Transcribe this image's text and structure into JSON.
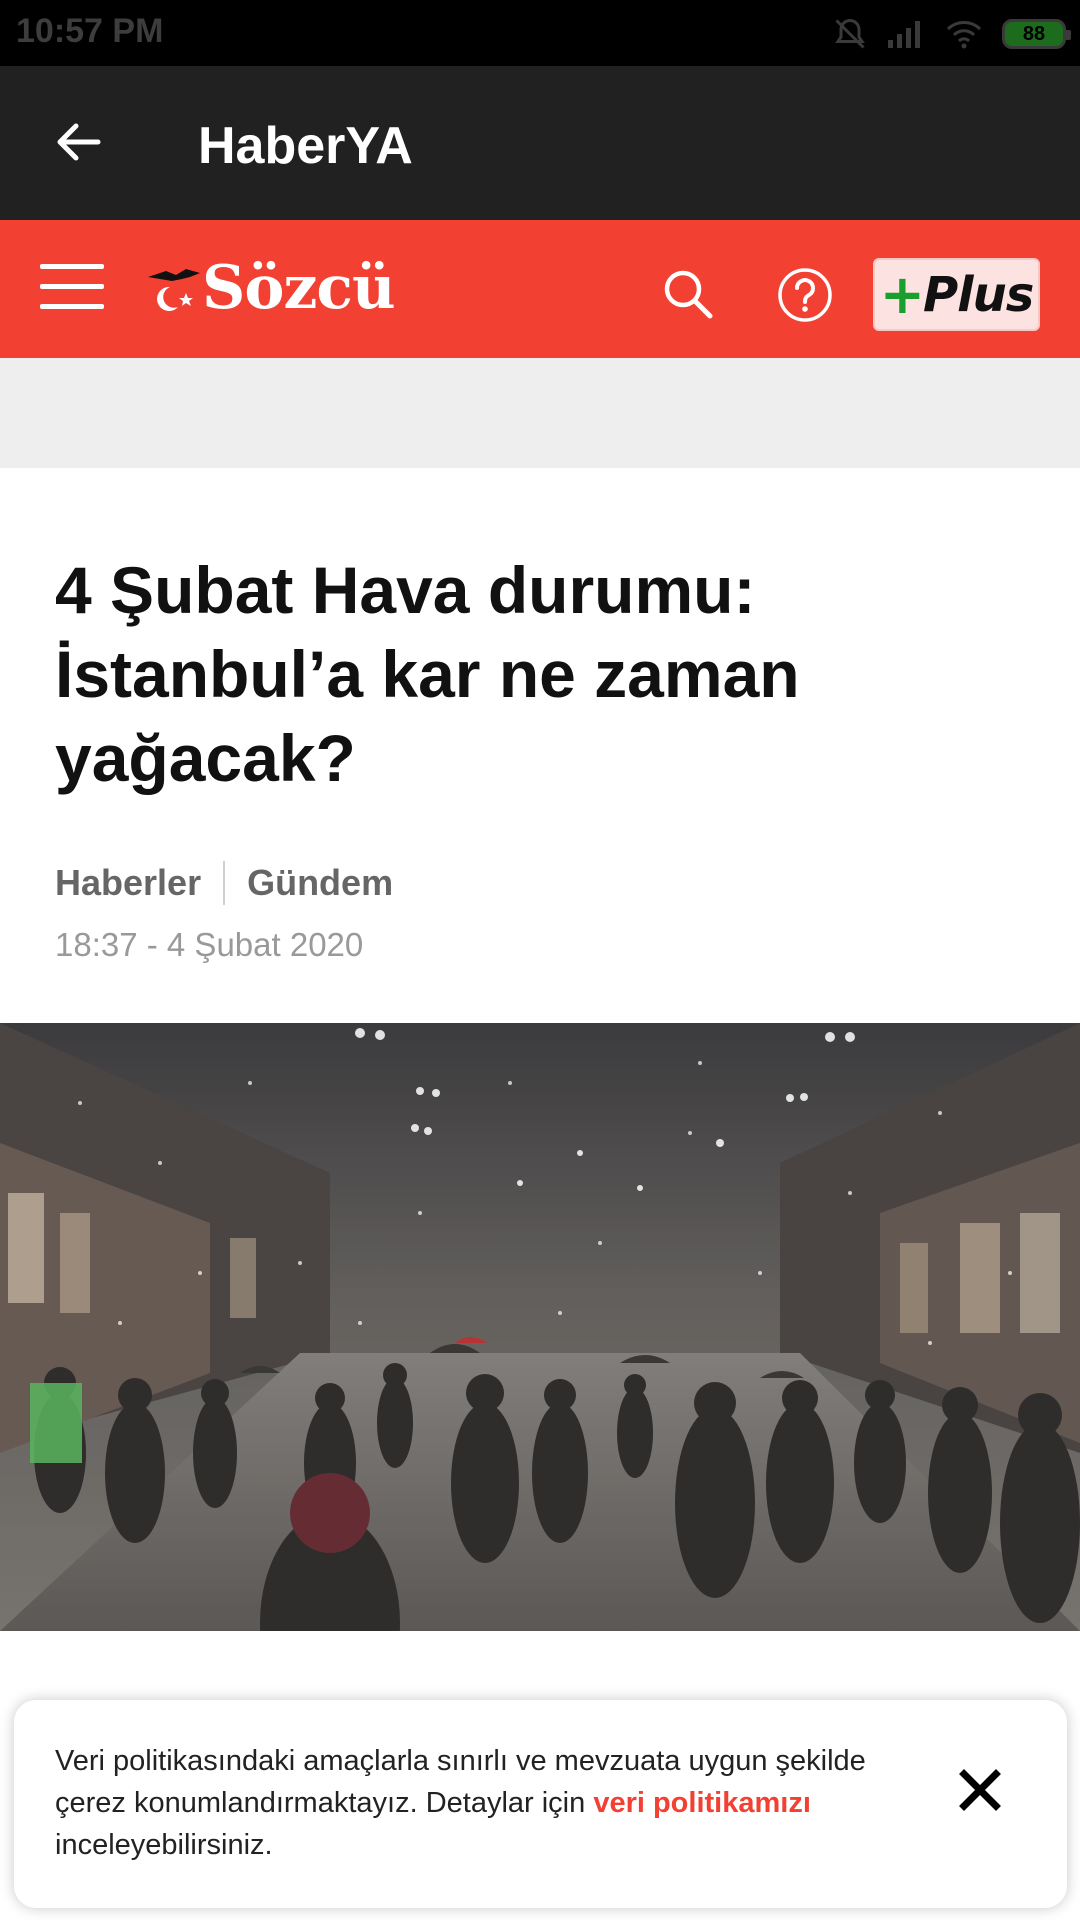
{
  "status_bar": {
    "time": "10:57 PM",
    "battery": "88",
    "icons": [
      "bell-off-icon",
      "signal-icon",
      "wifi-icon",
      "battery-icon"
    ]
  },
  "app_bar": {
    "title": "HaberYA",
    "back_icon": "arrow-left-icon"
  },
  "site_header": {
    "menu_icon": "hamburger-icon",
    "logo_text": "Sözcü",
    "search_icon": "search-icon",
    "help_icon": "help-icon",
    "plus_button": {
      "mark": "+",
      "label": "Plus"
    }
  },
  "article": {
    "headline": "4 Şubat Hava durumu: İstanbul’a kar ne zaman yağacak?",
    "category": "Haberler",
    "subcategory": "Gündem",
    "timestamp": "18:37 - 4 Şubat 2020"
  },
  "cookie_banner": {
    "text_before": "Veri politikasındaki amaçlarla sınırlı ve mevzuata uygun şekilde çerez konumlandırmaktayız. Detaylar için ",
    "link_text": "veri politikamızı",
    "text_after": " inceleyebilirsiniz."
  },
  "colors": {
    "brand_red": "#f24133",
    "app_bar": "#212121",
    "plus_green": "#1a9e2e"
  }
}
